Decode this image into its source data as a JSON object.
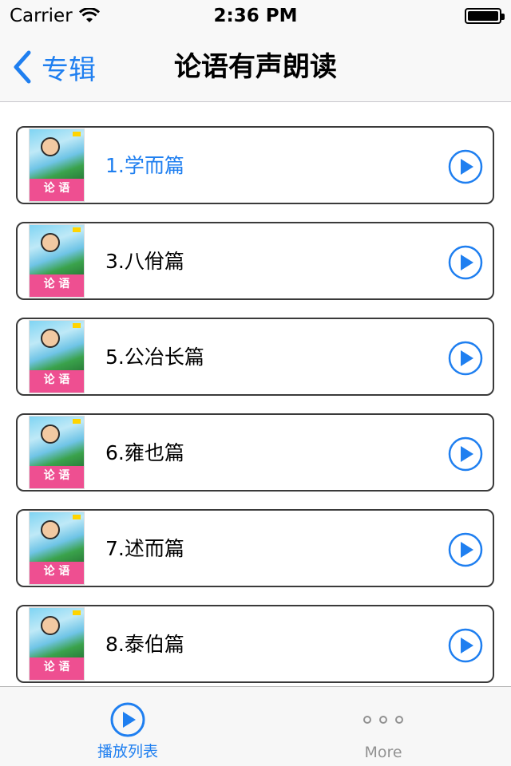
{
  "status_bar": {
    "carrier": "Carrier",
    "time": "2:36 PM",
    "wifi_icon": "wifi-icon",
    "battery_icon": "battery-icon"
  },
  "nav": {
    "back_label": "专辑",
    "back_icon": "chevron-left-icon",
    "title": "论语有声朗读"
  },
  "cover": {
    "title": "论 语",
    "icon": "book-cover-thumbnail"
  },
  "albums": [
    {
      "label": "1.学而篇",
      "selected": true
    },
    {
      "label": "3.八佾篇",
      "selected": false
    },
    {
      "label": "5.公冶长篇",
      "selected": false
    },
    {
      "label": "6.雍也篇",
      "selected": false
    },
    {
      "label": "7.述而篇",
      "selected": false
    },
    {
      "label": "8.泰伯篇",
      "selected": false
    }
  ],
  "play_icon": "play-circle-icon",
  "tab_bar": {
    "tabs": [
      {
        "label": "播放列表",
        "icon": "play-circle-icon",
        "active": true
      },
      {
        "label": "More",
        "icon": "more-dots-icon",
        "active": false
      }
    ]
  },
  "colors": {
    "accent": "#1f7ff0",
    "cover_pink": "#ee4f91",
    "border": "#3a3a3a"
  }
}
